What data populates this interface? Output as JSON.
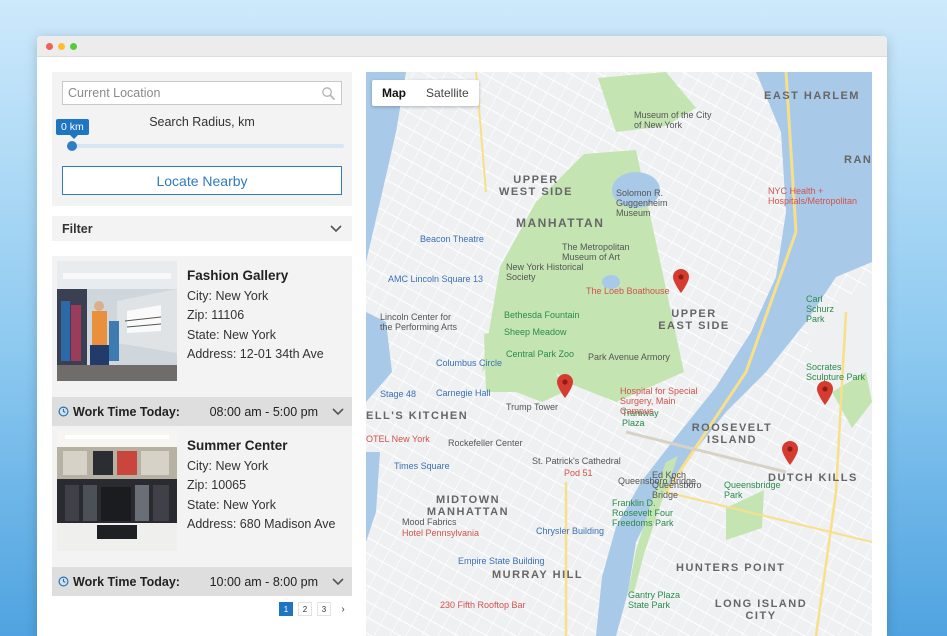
{
  "search": {
    "placeholder": "Current Location",
    "radius_label": "Search Radius, km",
    "radius_value": "0 km",
    "radius_fraction": 0,
    "locate_button": "Locate Nearby"
  },
  "filter": {
    "label": "Filter"
  },
  "stores": [
    {
      "name": "Fashion Gallery",
      "city": "City: New York",
      "zip": "Zip: 11106",
      "state": "State: New York",
      "address": "Address: 12-01 34th Ave",
      "worktime_label": "Work Time Today:",
      "worktime_value": "08:00 am - 5:00 pm"
    },
    {
      "name": "Summer Center",
      "city": "City: New York",
      "zip": "Zip: 10065",
      "state": "State: New York",
      "address": "Address: 680 Madison Ave",
      "worktime_label": "Work Time Today:",
      "worktime_value": "10:00 am - 8:00 pm"
    }
  ],
  "pagination": {
    "pages": [
      "1",
      "2",
      "3"
    ],
    "active": "1",
    "next": "›"
  },
  "map": {
    "type_map": "Map",
    "type_satellite": "Satellite",
    "area_labels": [
      "EAST HARLEM",
      "UPPER WEST SIDE",
      "MANHATTAN",
      "UPPER EAST SIDE",
      "ROOSEVELT ISLAND",
      "DUTCH KILLS",
      "MIDTOWN MANHATTAN",
      "MURRAY HILL",
      "HUNTERS POINT",
      "LONG ISLAND CITY",
      "ELL'S KITCHEN",
      "RAND"
    ],
    "poi_labels": [
      "The Metropolitan Museum of Art",
      "Solomon R. Guggenheim Museum",
      "New York Historical Society",
      "Bethesda Fountain",
      "Sheep Meadow",
      "Central Park Zoo",
      "Carl Schurz Park",
      "Socrates Sculpture Park",
      "Queensbridge Park",
      "Franklin D. Roosevelt Four Freedoms Park",
      "Gantry Plaza State Park",
      "Tramway Plaza"
    ],
    "other_labels": [
      "Beacon Theatre",
      "AMC Lincoln Square 13",
      "Lincoln Center for the Performing Arts",
      "Columbus Circle",
      "Carnegie Hall",
      "Trump Tower",
      "Park Avenue Armory",
      "Rockefeller Center",
      "St. Patrick's Cathedral",
      "Times Square",
      "Chrysler Building",
      "Empire State Building",
      "Mood Fabrics",
      "Stage 48",
      "Ed Koch Queensboro Bridge",
      "Queensboro Bridge"
    ],
    "red_labels": [
      "NYC Health + Hospitals/Metropolitan",
      "The Loeb Boathouse",
      "Hospital for Special Surgery, Main Campus",
      "Pod 51",
      "Hotel Pennsylvania",
      "230 Fifth Rooftop Bar",
      "OTEL New York",
      "Museum of the City of New York"
    ],
    "colors": {
      "water": "#a9c9e8",
      "park": "#c4e5b2",
      "land": "#eef0f2",
      "road": "#ffffff",
      "highway": "#f8df8a",
      "pin": "#d63b30"
    }
  }
}
